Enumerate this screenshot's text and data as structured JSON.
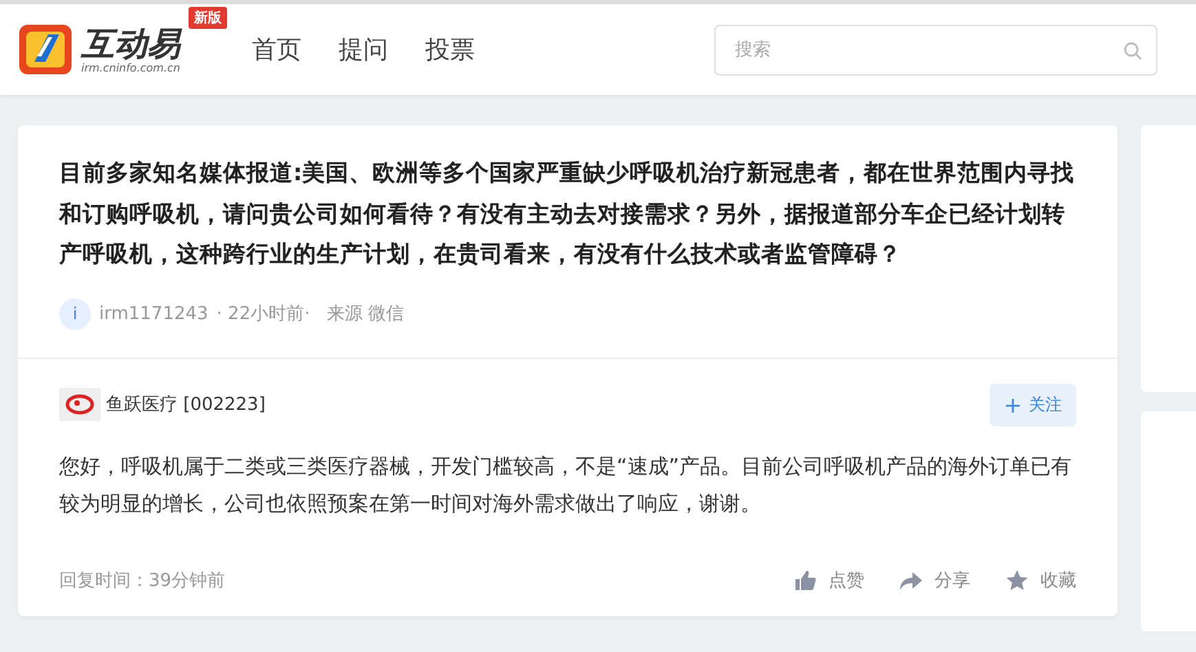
{
  "header": {
    "logo_title": "互动易",
    "logo_url": "irm.cninfo.com.cn",
    "badge": "新版",
    "nav": [
      {
        "label": "首页"
      },
      {
        "label": "提问"
      },
      {
        "label": "投票"
      }
    ],
    "search": {
      "placeholder": "搜索"
    }
  },
  "question": {
    "text": "目前多家知名媒体报道:美国、欧洲等多个国家严重缺少呼吸机治疗新冠患者，都在世界范围内寻找和订购呼吸机，请问贵公司如何看待？有没有主动去对接需求？另外，据报道部分车企已经计划转产呼吸机，这种跨行业的生产计划，在贵司看来，有没有什么技术或者监管障碍？",
    "avatar_letter": "i",
    "user": "irm1171243",
    "time": "· 22小时前·",
    "source": "来源 微信"
  },
  "answer": {
    "company": "鱼跃医疗 [002223]",
    "follow_icon": "+",
    "follow": "关注",
    "text": "您好，呼吸机属于二类或三类医疗器械，开发门槛较高，不是“速成”产品。目前公司呼吸机产品的海外订单已有较为明显的增长，公司也依照预案在第一时间对海外需求做出了响应，谢谢。",
    "reply_time": "回复时间：39分钟前",
    "actions": [
      {
        "kind": "like",
        "label": "点赞"
      },
      {
        "kind": "share",
        "label": "分享"
      },
      {
        "kind": "favorite",
        "label": "收藏"
      }
    ]
  }
}
